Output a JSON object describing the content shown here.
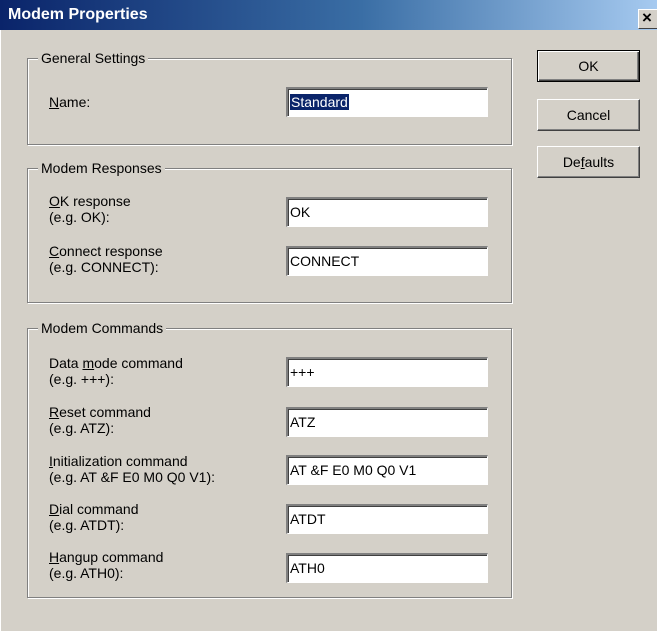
{
  "window": {
    "title": "Modem Properties",
    "close_glyph": "×"
  },
  "buttons": {
    "ok": "OK",
    "cancel": "Cancel",
    "defaults_pre": "De",
    "defaults_u": "f",
    "defaults_post": "aults"
  },
  "general": {
    "legend": "General Settings",
    "name_label_u": "N",
    "name_label_rest": "ame:",
    "name_value": "Standard"
  },
  "responses": {
    "legend": "Modem Responses",
    "ok_label_u": "O",
    "ok_label_rest": "K response",
    "ok_hint": "(e.g. OK):",
    "ok_value": "OK",
    "connect_label_u": "C",
    "connect_label_rest": "onnect response",
    "connect_hint": "(e.g. CONNECT):",
    "connect_value": "CONNECT"
  },
  "commands": {
    "legend": "Modem Commands",
    "data_pre": "Data ",
    "data_u": "m",
    "data_post": "ode command",
    "data_hint": "(e.g. +++):",
    "data_value": "+++",
    "reset_u": "R",
    "reset_rest": "eset command",
    "reset_hint": "(e.g. ATZ):",
    "reset_value": "ATZ",
    "init_u": "I",
    "init_rest": "nitialization command",
    "init_hint": "(e.g. AT &F E0 M0 Q0 V1):",
    "init_value": "AT &F E0 M0 Q0 V1",
    "dial_u": "D",
    "dial_rest": "ial command",
    "dial_hint": "(e.g. ATDT):",
    "dial_value": "ATDT",
    "hangup_u": "H",
    "hangup_rest": "angup command",
    "hangup_hint": "(e.g. ATH0):",
    "hangup_value": "ATH0"
  }
}
